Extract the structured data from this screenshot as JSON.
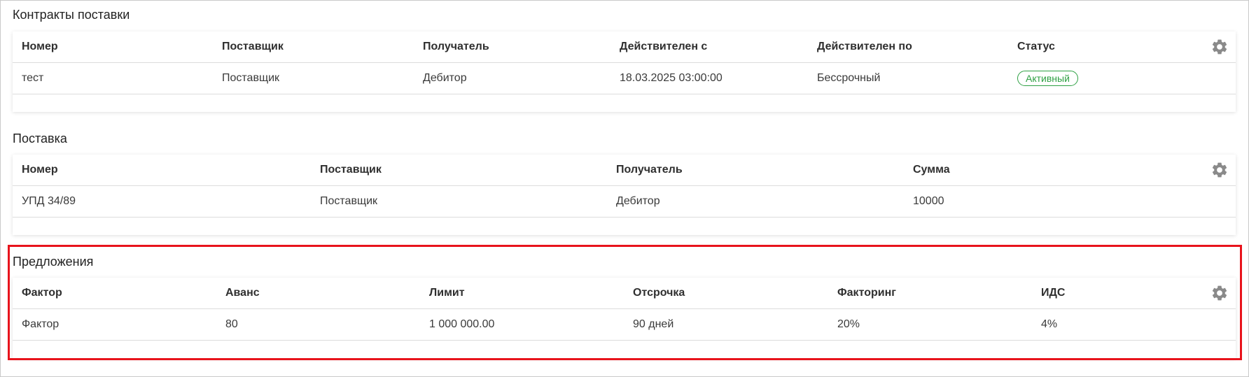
{
  "contracts": {
    "title": "Контракты поставки",
    "columns": [
      "Номер",
      "Поставщик",
      "Получатель",
      "Действителен с",
      "Действителен по",
      "Статус"
    ],
    "row": {
      "number": "тест",
      "supplier": "Поставщик",
      "recipient": "Дебитор",
      "valid_from": "18.03.2025 03:00:00",
      "valid_to": "Бессрочный",
      "status": "Активный"
    },
    "settings_icon": "gear-icon",
    "status_color": "#2ea043"
  },
  "supply": {
    "title": "Поставка",
    "columns": [
      "Номер",
      "Поставщик",
      "Получатель",
      "Сумма"
    ],
    "row": {
      "number": "УПД 34/89",
      "supplier": "Поставщик",
      "recipient": "Дебитор",
      "amount": "10000"
    },
    "settings_icon": "gear-icon"
  },
  "offers": {
    "title": "Предложения",
    "columns": [
      "Фактор",
      "Аванс",
      "Лимит",
      "Отсрочка",
      "Факторинг",
      "ИДС"
    ],
    "row": {
      "factor": "Фактор",
      "advance": "80",
      "limit": "1 000 000.00",
      "deferral": "90 дней",
      "factoring": "20%",
      "ids": "4%"
    },
    "settings_icon": "gear-icon",
    "highlight_color": "#e8131c"
  }
}
